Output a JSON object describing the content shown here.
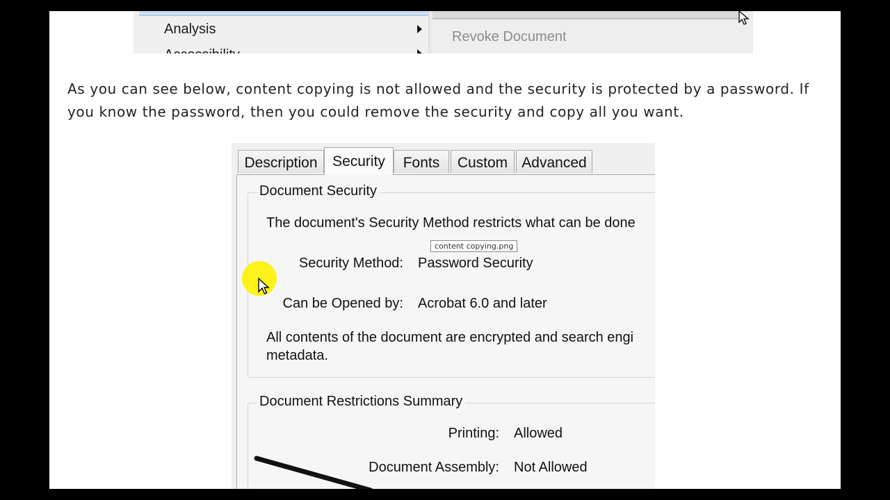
{
  "menu": {
    "items": [
      {
        "label": "Analysis"
      },
      {
        "label": "Accessibility"
      }
    ],
    "submenu_item": "Revoke Document"
  },
  "paragraph": "As you can see below, content copying is not allowed and the security is protected by a password. If you know the password, then you could remove the security and copy all you want.",
  "dialog": {
    "tabs": [
      "Description",
      "Security",
      "Fonts",
      "Custom",
      "Advanced"
    ],
    "active_tab": "Security",
    "document_security": {
      "title": "Document Security",
      "intro": "The document's Security Method restricts what can be done",
      "method_label": "Security Method:",
      "method_value": "Password Security",
      "opened_label": "Can be Opened by:",
      "opened_value": "Acrobat 6.0 and later",
      "note_line1": "All contents of the document are encrypted and search engi",
      "note_line2": "metadata."
    },
    "restrictions": {
      "title": "Document Restrictions Summary",
      "printing_label": "Printing:",
      "printing_value": "Allowed",
      "assembly_label": "Document Assembly:",
      "assembly_value": "Not Allowed"
    },
    "tooltip": "content copying.png"
  },
  "colors": {
    "letterbox": "#000000",
    "highlight": "#fff200"
  }
}
